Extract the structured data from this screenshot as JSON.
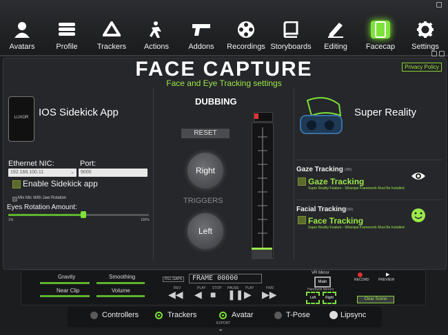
{
  "nav": [
    {
      "label": "Avatars",
      "icon": "person-icon"
    },
    {
      "label": "Profile",
      "icon": "profile-stack-icon"
    },
    {
      "label": "Trackers",
      "icon": "tracker-icon"
    },
    {
      "label": "Actions",
      "icon": "actions-icon"
    },
    {
      "label": "Addons",
      "icon": "gun-icon"
    },
    {
      "label": "Recordings",
      "icon": "film-reel-icon"
    },
    {
      "label": "Storyboards",
      "icon": "book-icon"
    },
    {
      "label": "Editing",
      "icon": "pencil-icon"
    },
    {
      "label": "Facecap",
      "icon": "phone-icon"
    },
    {
      "label": "Settings",
      "icon": "gear-icon"
    }
  ],
  "page": {
    "title": "FACE CAPTURE",
    "subtitle": "Face and Eye Tracking settings",
    "privacy": "Privacy Policy"
  },
  "ios": {
    "title": "IOS Sidekick App",
    "logo": "LUXOR",
    "nic_label": "Ethernet NIC:",
    "nic_value": "192.168.100.11",
    "port_label": "Port:",
    "port_value": "9000",
    "enable_label": "Enable Sidekick app",
    "mix_label": "Mix Mic With Jaw Rotation",
    "eye_label": "Eyes Rotation Amount:",
    "eye_min": "1%",
    "eye_max": "100%"
  },
  "dubbing": {
    "title": "DUBBING",
    "reset": "RESET",
    "right": "Right",
    "triggers": "TRIGGERS",
    "left": "Left"
  },
  "super": {
    "title": "Super Reality",
    "gaze_header": "Gaze Tracking",
    "gaze_badge": "(SR)",
    "gaze_label": "Gaze Tracking",
    "gaze_note": "Super Reality Feature - SRanipal Framework Must Be Installed",
    "facial_header": "Facial Tracking",
    "facial_badge": "(SR)",
    "facial_label": "Face Tracking",
    "facial_note": "Super Reality Feature - SRanipal Framework Must Be Installed"
  },
  "bottom": {
    "gravity": "Gravity",
    "smoothing": "Smoothing",
    "nearclip": "Near Clip",
    "volume": "Volume",
    "frame_label": "FRAME",
    "frame_value": "00000",
    "fill_label": "FILL GAPS",
    "rev": "REV",
    "play": "PLAY",
    "stop": "STOP",
    "pause": "PAUSE",
    "fwd": "FWD",
    "vr_mirror": "VR Mirror",
    "main": "Main",
    "handheld": "Handheld Mirrors",
    "left": "Left",
    "right": "Right",
    "record": "RECORD",
    "preview": "PREVIEW",
    "clear": "Clear Scene"
  },
  "bar": {
    "controllers": "Controllers",
    "trackers": "Trackers",
    "avatar": "Avatar",
    "tpose": "T-Pose",
    "lipsync": "Lipsync",
    "export": "EXPORT"
  },
  "colors": {
    "accent": "#7de23a",
    "panel": "#26272a"
  }
}
